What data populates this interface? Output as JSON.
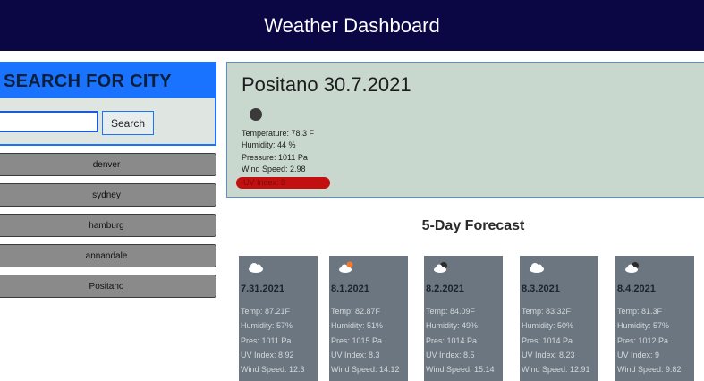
{
  "header": {
    "title": "Weather Dashboard"
  },
  "search": {
    "title": "SEARCH FOR CITY",
    "input_value": "",
    "button_label": "Search",
    "history": [
      "denver",
      "sydney",
      "hamburg",
      "annandale",
      "Positano"
    ]
  },
  "current": {
    "title": "Positano 30.7.2021",
    "temperature": "Temperature: 78.3 F",
    "humidity": "Humidity: 44 %",
    "pressure": "Pressure: 1011 Pa",
    "wind": "Wind Speed: 2.98",
    "uv": "UV Index: 8"
  },
  "forecast": {
    "title": "5-Day Forecast",
    "days": [
      {
        "date": "7.31.2021",
        "icon": "cloud-icon",
        "temp": "Temp: 87.21F",
        "humidity": "Humidity: 57%",
        "pres": "Pres: 1011 Pa",
        "uv": "UV Index: 8.92",
        "wind": "Wind Speed: 12.3"
      },
      {
        "date": "8.1.2021",
        "icon": "cloud-sun-icon",
        "temp": "Temp: 82.87F",
        "humidity": "Humidity: 51%",
        "pres": "Pres: 1015 Pa",
        "uv": "UV Index: 8.3",
        "wind": "Wind Speed: 14.12"
      },
      {
        "date": "8.2.2021",
        "icon": "cloud-dark-icon",
        "temp": "Temp: 84.09F",
        "humidity": "Humidity: 49%",
        "pres": "Pres: 1014 Pa",
        "uv": "UV Index: 8.5",
        "wind": "Wind Speed: 15.14"
      },
      {
        "date": "8.3.2021",
        "icon": "cloud-icon",
        "temp": "Temp: 83.32F",
        "humidity": "Humidity: 50%",
        "pres": "Pres: 1014 Pa",
        "uv": "UV Index: 8.23",
        "wind": "Wind Speed: 12.91"
      },
      {
        "date": "8.4.2021",
        "icon": "cloud-dark-icon",
        "temp": "Temp: 81.3F",
        "humidity": "Humidity: 57%",
        "pres": "Pres: 1012 Pa",
        "uv": "UV Index: 9",
        "wind": "Wind Speed: 9.82"
      }
    ]
  }
}
